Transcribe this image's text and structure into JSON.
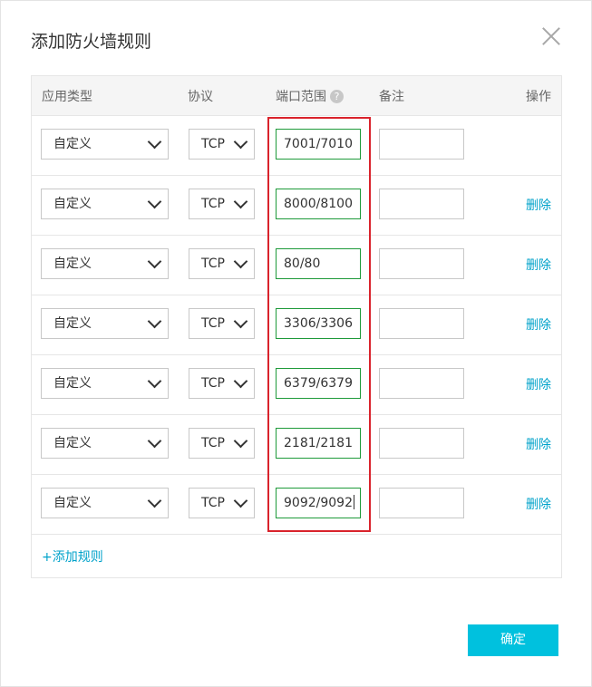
{
  "dialog": {
    "title": "添加防火墙规则",
    "confirm_label": "确定",
    "add_rule_label": "+添加规则"
  },
  "columns": {
    "app_type": "应用类型",
    "protocol": "协议",
    "port_range": "端口范围",
    "note": "备注",
    "action": "操作",
    "help_glyph": "?"
  },
  "rows": [
    {
      "app_type": "自定义",
      "protocol": "TCP",
      "port_range": "7001/7010",
      "note": "",
      "action": ""
    },
    {
      "app_type": "自定义",
      "protocol": "TCP",
      "port_range": "8000/8100",
      "note": "",
      "action": "删除"
    },
    {
      "app_type": "自定义",
      "protocol": "TCP",
      "port_range": "80/80",
      "note": "",
      "action": "删除"
    },
    {
      "app_type": "自定义",
      "protocol": "TCP",
      "port_range": "3306/3306",
      "note": "",
      "action": "删除"
    },
    {
      "app_type": "自定义",
      "protocol": "TCP",
      "port_range": "6379/6379",
      "note": "",
      "action": "删除"
    },
    {
      "app_type": "自定义",
      "protocol": "TCP",
      "port_range": "2181/2181",
      "note": "",
      "action": "删除"
    },
    {
      "app_type": "自定义",
      "protocol": "TCP",
      "port_range": "9092/9092",
      "note": "",
      "action": "删除"
    }
  ],
  "colors": {
    "accent": "#00c1de",
    "link": "#00a2ca",
    "highlight": "#d9232c",
    "input_active_border": "#1e9a3a"
  }
}
